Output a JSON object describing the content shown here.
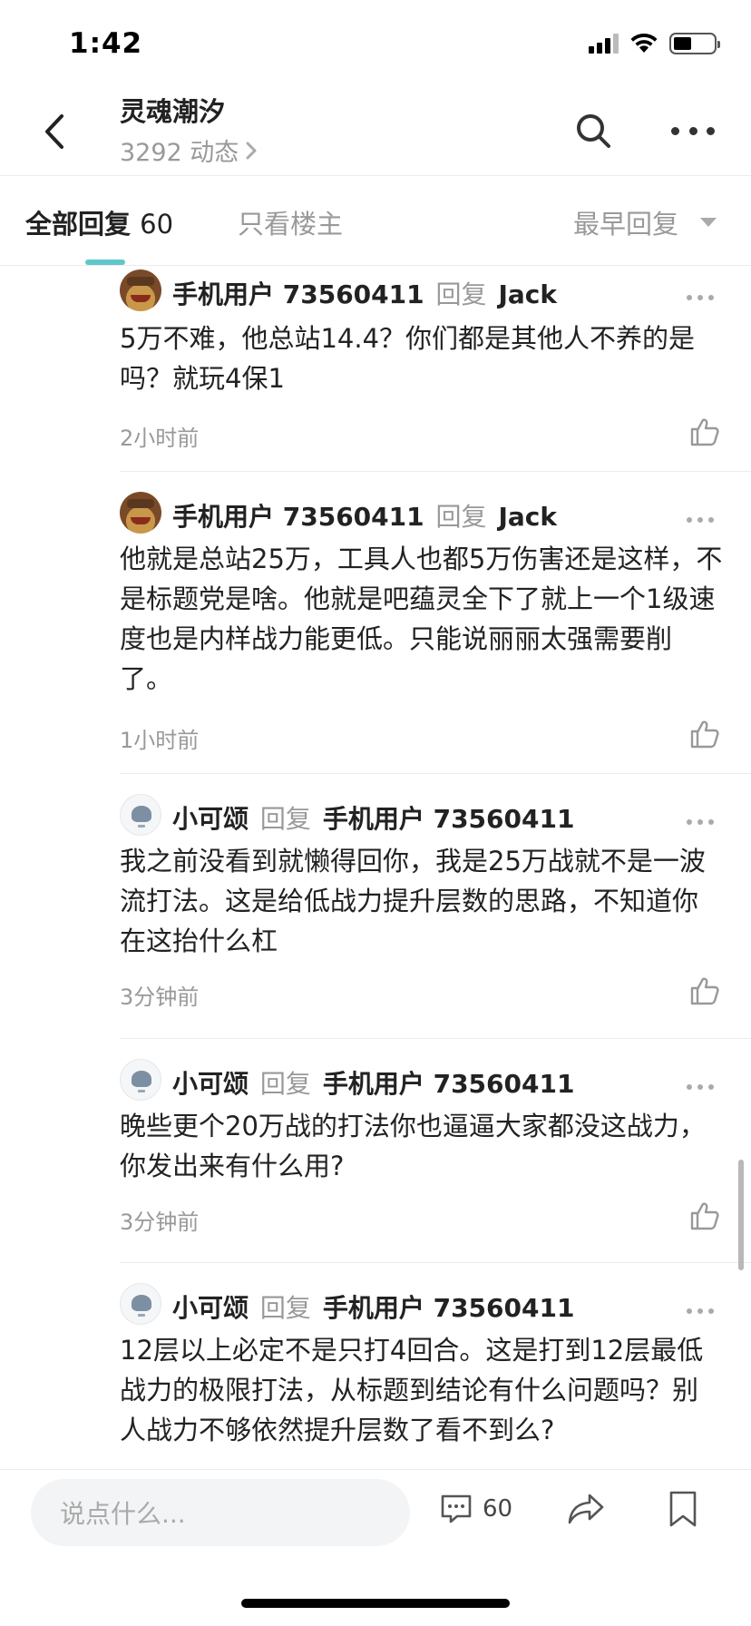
{
  "status_bar": {
    "time": "1:42"
  },
  "header": {
    "title": "灵魂潮汐",
    "subtitle": "3292 动态"
  },
  "tabs": {
    "all_label": "全部回复",
    "all_count": "60",
    "owner_label": "只看楼主",
    "sort_label": "最早回复"
  },
  "comments": [
    {
      "user": "手机用户 73560411",
      "reply_word": "回复",
      "target": "Jack",
      "body": "5万不难，他总站14.4？你们都是其他人不养的是吗？就玩4保1",
      "time": "2小时前",
      "avatar": "clash-king-avatar"
    },
    {
      "user": "手机用户 73560411",
      "reply_word": "回复",
      "target": "Jack",
      "body": "他就是总站25万，工具人也都5万伤害还是这样，不是标题党是啥。他就是吧蕴灵全下了就上一个1级速度也是内样战力能更低。只能说丽丽太强需要削了。",
      "time": "1小时前",
      "avatar": "clash-king-avatar"
    },
    {
      "user": "小可颂",
      "reply_word": "回复",
      "target": "手机用户 73560411",
      "body": "我之前没看到就懒得回你，我是25万战就不是一波流打法。这是给低战力提升层数的思路，不知道你在这抬什么杠",
      "time": "3分钟前",
      "avatar": "sketch-avatar"
    },
    {
      "user": "小可颂",
      "reply_word": "回复",
      "target": "手机用户 73560411",
      "body": "晚些更个20万战的打法你也逼逼大家都没这战力，你发出来有什么用?",
      "time": "3分钟前",
      "avatar": "sketch-avatar"
    },
    {
      "user": "小可颂",
      "reply_word": "回复",
      "target": "手机用户 73560411",
      "body": "12层以上必定不是只打4回合。这是打到12层最低战力的极限打法，从标题到结论有什么问题吗？别人战力不够依然提升层数了看不到么?",
      "time": "",
      "avatar": "sketch-avatar"
    }
  ],
  "bottom_bar": {
    "input_placeholder": "说点什么...",
    "comment_count": "60"
  },
  "colors": {
    "accent": "#5fc7c9",
    "muted": "#999999",
    "text": "#222222"
  }
}
